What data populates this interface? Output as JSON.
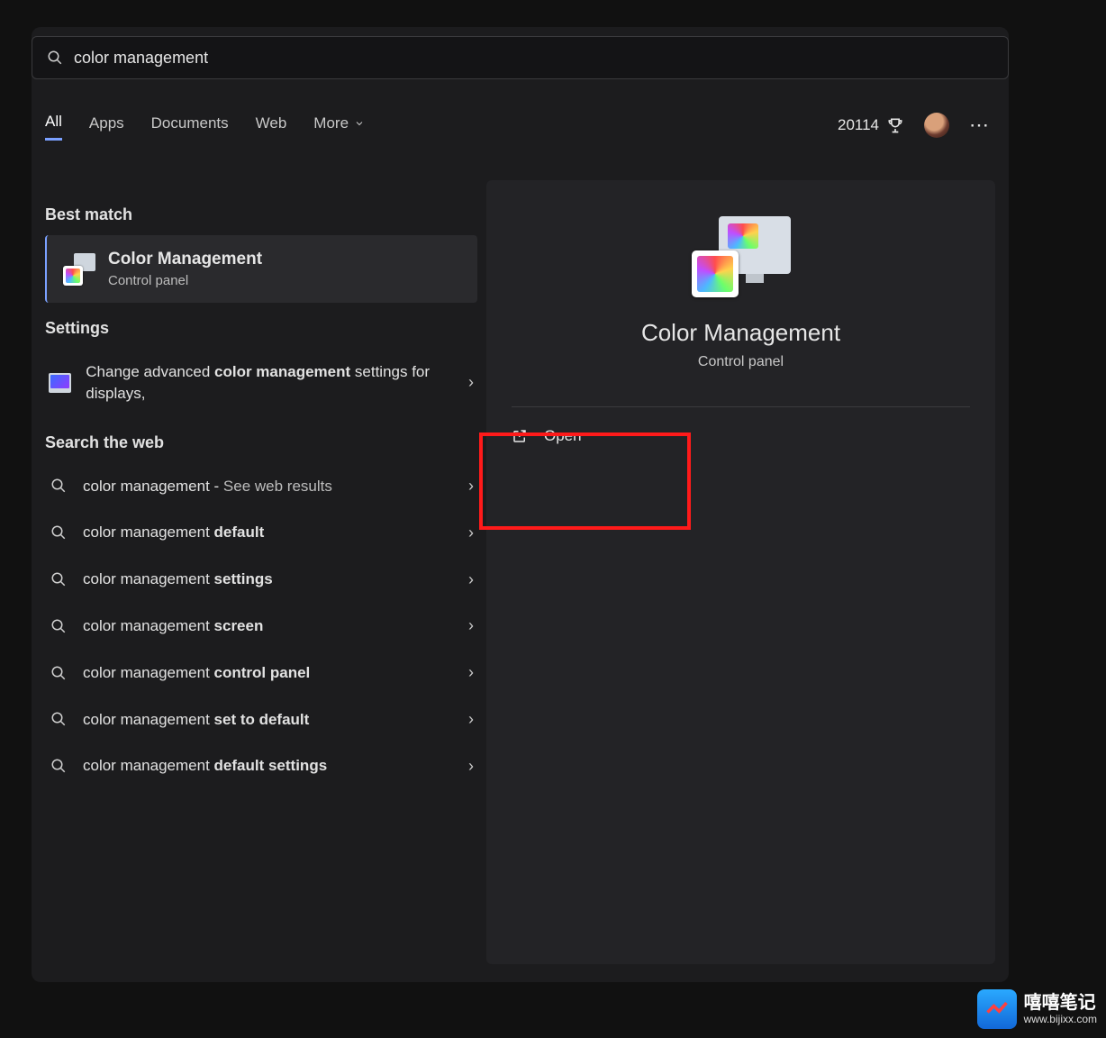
{
  "search": {
    "query": "color management"
  },
  "tabs": {
    "all": "All",
    "apps": "Apps",
    "documents": "Documents",
    "web": "Web",
    "more": "More"
  },
  "header": {
    "points": "20114"
  },
  "left": {
    "best_label": "Best match",
    "best": {
      "title": "Color Management",
      "subtitle": "Control panel"
    },
    "settings_label": "Settings",
    "setting1_pre": "Change advanced ",
    "setting1_b1": "color management",
    "setting1_post": " settings for displays,",
    "web_label": "Search the web",
    "web1_pre": "color management - ",
    "web1_suf": "See web results",
    "web2_pre": "color management ",
    "web2_b": "default",
    "web3_pre": "color management ",
    "web3_b": "settings",
    "web4_pre": "color management ",
    "web4_b": "screen",
    "web5_pre": "color management ",
    "web5_b": "control panel",
    "web6_pre": "color management ",
    "web6_b": "set to default",
    "web7_pre": "color management ",
    "web7_b": "default settings"
  },
  "detail": {
    "title": "Color Management",
    "subtitle": "Control panel",
    "open": "Open"
  },
  "watermark": {
    "line1": "嘻嘻笔记",
    "line2": "www.bijixx.com"
  }
}
